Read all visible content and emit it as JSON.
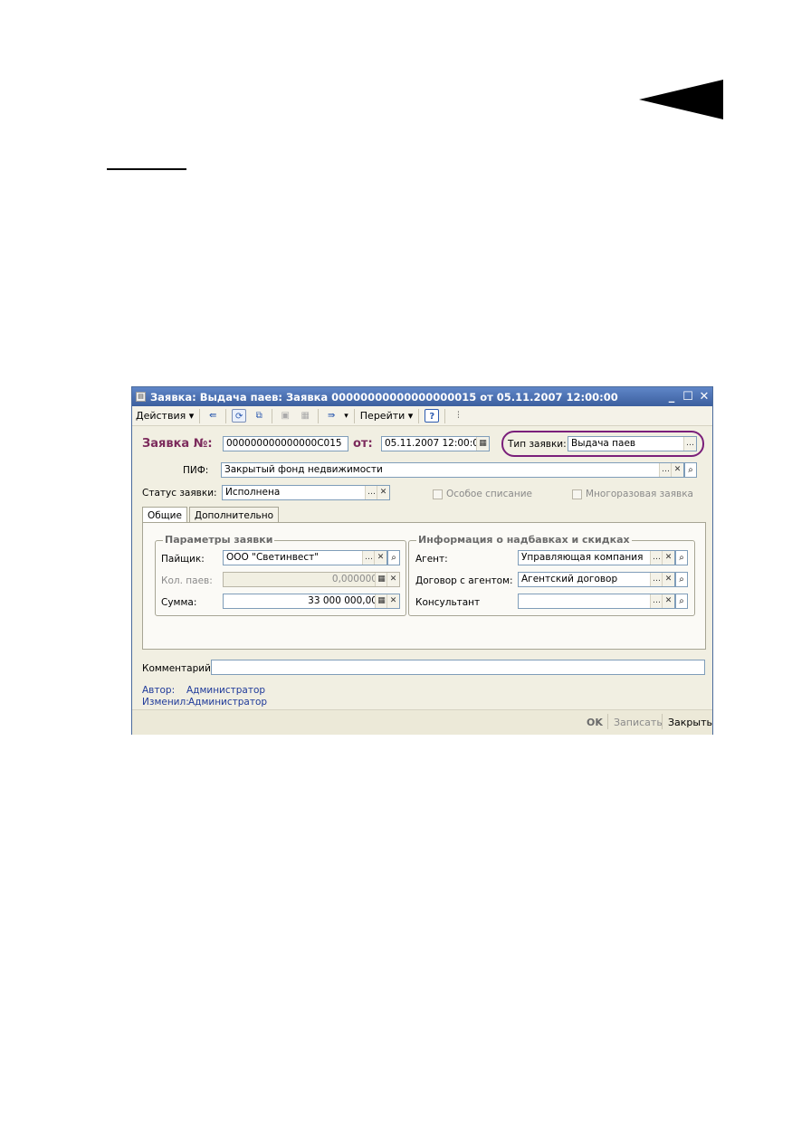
{
  "window": {
    "title": "Заявка: Выдача паев: Заявка 00000000000000000015 от 05.11.2007 12:00:00",
    "min_label": "_",
    "max_label": "☐",
    "close_label": "✕"
  },
  "toolbar": {
    "actions_label": "Действия",
    "goto_label": "Перейти",
    "help_label": "?"
  },
  "header": {
    "number_label": "Заявка №:",
    "number_value": "000000000000000C015",
    "date_label": "от:",
    "date_value": "05.11.2007 12:00:00",
    "type_label": "Тип заявки:",
    "type_value": "Выдача паев",
    "pif_label": "ПИФ:",
    "pif_value": "Закрытый фонд недвижимости",
    "status_label": "Статус заявки:",
    "status_value": "Исполнена",
    "special_writeoff_label": "Особое списание",
    "multi_label": "Многоразовая заявка"
  },
  "tabs": [
    {
      "label": "Общие"
    },
    {
      "label": "Дополнительно"
    }
  ],
  "params_group": {
    "title": "Параметры заявки",
    "holder_label": "Пайщик:",
    "holder_value": "ООО \"Светинвест\"",
    "units_label": "Кол. паев:",
    "units_value": "0,000000",
    "sum_label": "Сумма:",
    "sum_value": "33 000 000,00"
  },
  "info_group": {
    "title": "Информация о надбавках и скидках",
    "agent_label": "Агент:",
    "agent_value": "Управляющая компания",
    "contract_label": "Договор с агентом:",
    "contract_value": "Агентский договор",
    "consultant_label": "Консультант",
    "consultant_value": ""
  },
  "footer": {
    "comment_label": "Комментарий:",
    "comment_value": "",
    "author_label": "Автор:",
    "author_value": "Администратор",
    "changed_label": "Изменил:",
    "changed_value": "Администратор"
  },
  "buttons": {
    "ok": "OK",
    "save": "Записать",
    "close": "Закрыть"
  }
}
